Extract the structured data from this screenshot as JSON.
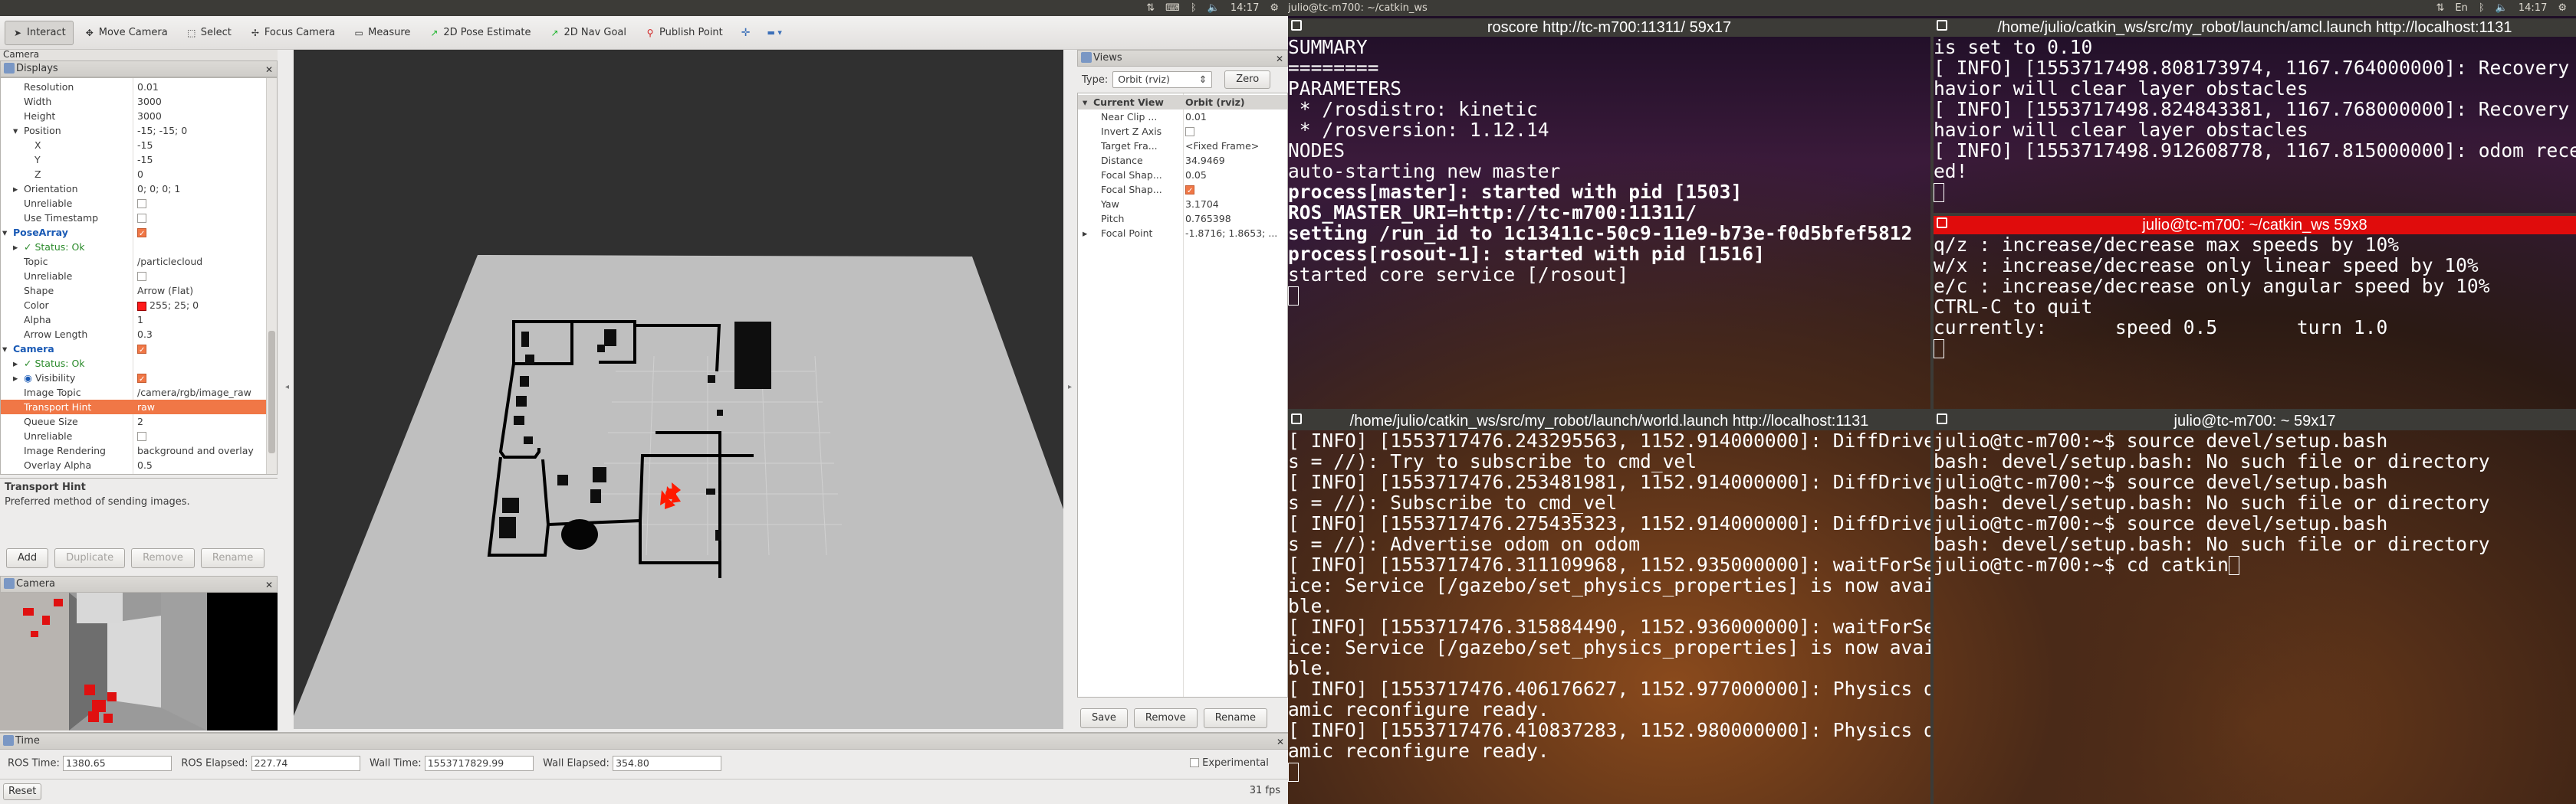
{
  "top_left": {
    "title": "",
    "time": "14:17"
  },
  "top_right": {
    "title": "julio@tc-m700: ~/catkin_ws",
    "time": "14:17",
    "lang": "En"
  },
  "toolbar": {
    "tools": [
      {
        "label": "Interact",
        "icon": "cursor-icon"
      },
      {
        "label": "Move Camera",
        "icon": "move-icon"
      },
      {
        "label": "Select",
        "icon": "select-icon"
      },
      {
        "label": "Focus Camera",
        "icon": "focus-icon"
      },
      {
        "label": "Measure",
        "icon": "ruler-icon"
      },
      {
        "label": "2D Pose Estimate",
        "icon": "pose-arrow-icon"
      },
      {
        "label": "2D Nav Goal",
        "icon": "goal-arrow-icon"
      },
      {
        "label": "Publish Point",
        "icon": "pin-icon"
      }
    ]
  },
  "camera_tab": "Camera",
  "displays": {
    "title": "Displays",
    "rows": [
      {
        "k": "Resolution",
        "v": "0.01",
        "ind": 2
      },
      {
        "k": "Width",
        "v": "3000",
        "ind": 2
      },
      {
        "k": "Height",
        "v": "3000",
        "ind": 2
      },
      {
        "k": "Position",
        "v": "-15; -15; 0",
        "ind": 2,
        "exp": "▾"
      },
      {
        "k": "X",
        "v": "-15",
        "ind": 3
      },
      {
        "k": "Y",
        "v": "-15",
        "ind": 3
      },
      {
        "k": "Z",
        "v": "0",
        "ind": 3
      },
      {
        "k": "Orientation",
        "v": "0; 0; 0; 1",
        "ind": 2,
        "exp": "▸"
      },
      {
        "k": "Unreliable",
        "v": "",
        "ind": 2,
        "chk": "off"
      },
      {
        "k": "Use Timestamp",
        "v": "",
        "ind": 2,
        "chk": "off"
      },
      {
        "k": "PoseArray",
        "v": "",
        "ind": 1,
        "exp": "▾",
        "chk": "on",
        "cls": "blue"
      },
      {
        "k": "Status: Ok",
        "v": "",
        "ind": 2,
        "exp": "▸",
        "cls": "green",
        "prefix": "✓"
      },
      {
        "k": "Topic",
        "v": "/particlecloud",
        "ind": 2
      },
      {
        "k": "Unreliable",
        "v": "",
        "ind": 2,
        "chk": "off"
      },
      {
        "k": "Shape",
        "v": "Arrow (Flat)",
        "ind": 2
      },
      {
        "k": "Color",
        "v": "255; 25; 0",
        "ind": 2,
        "swatch": true
      },
      {
        "k": "Alpha",
        "v": "1",
        "ind": 2
      },
      {
        "k": "Arrow Length",
        "v": "0.3",
        "ind": 2
      },
      {
        "k": "Camera",
        "v": "",
        "ind": 1,
        "exp": "▾",
        "chk": "on",
        "cls": "blue"
      },
      {
        "k": "Status: Ok",
        "v": "",
        "ind": 2,
        "exp": "▸",
        "cls": "green",
        "prefix": "✓"
      },
      {
        "k": "Visibility",
        "v": "",
        "ind": 2,
        "exp": "▸",
        "chk": "on",
        "prefix": "◉"
      },
      {
        "k": "Image Topic",
        "v": "/camera/rgb/image_raw",
        "ind": 2
      },
      {
        "k": "Transport Hint",
        "v": "raw",
        "ind": 2,
        "selected": true
      },
      {
        "k": "Queue Size",
        "v": "2",
        "ind": 2
      },
      {
        "k": "Unreliable",
        "v": "",
        "ind": 2,
        "chk": "off"
      },
      {
        "k": "Image Rendering",
        "v": "background and overlay",
        "ind": 2
      },
      {
        "k": "Overlay Alpha",
        "v": "0.5",
        "ind": 2
      }
    ]
  },
  "description": {
    "title": "Transport Hint",
    "text": "Preferred method of sending images."
  },
  "display_buttons": {
    "add": "Add",
    "duplicate": "Duplicate",
    "remove": "Remove",
    "rename": "Rename"
  },
  "camera_panel": {
    "title": "Camera"
  },
  "views": {
    "title": "Views",
    "type_label": "Type:",
    "type_value": "Orbit (rviz)",
    "zero": "Zero",
    "rows": [
      {
        "k": "Current View",
        "v": "Orbit (rviz)",
        "hdr": true
      },
      {
        "k": "Near Clip ...",
        "v": "0.01"
      },
      {
        "k": "Invert Z Axis",
        "v": "",
        "chk": "off"
      },
      {
        "k": "Target Fra...",
        "v": "<Fixed Frame>"
      },
      {
        "k": "Distance",
        "v": "34.9469"
      },
      {
        "k": "Focal Shap...",
        "v": "0.05"
      },
      {
        "k": "Focal Shap...",
        "v": "",
        "chk": "on"
      },
      {
        "k": "Yaw",
        "v": "3.1704"
      },
      {
        "k": "Pitch",
        "v": "0.765398"
      },
      {
        "k": "Focal Point",
        "v": "-1.8716; 1.8653; ...",
        "exp": true
      }
    ],
    "save": "Save",
    "remove": "Remove",
    "rename": "Rename"
  },
  "time_panel": {
    "title": "Time",
    "ros_time_label": "ROS Time:",
    "ros_time": "1380.65",
    "ros_elapsed_label": "ROS Elapsed:",
    "ros_elapsed": "227.74",
    "wall_time_label": "Wall Time:",
    "wall_time": "1553717829.99",
    "wall_elapsed_label": "Wall Elapsed:",
    "wall_elapsed": "354.80",
    "experimental": "Experimental",
    "reset": "Reset",
    "fps": "31 fps"
  },
  "panes": {
    "roscore": {
      "title": "roscore http://tc-m700:11311/ 59x17",
      "lines": [
        {
          "t": "SUMMARY"
        },
        {
          "t": "========"
        },
        {
          "t": ""
        },
        {
          "t": "PARAMETERS"
        },
        {
          "t": " * /rosdistro: kinetic"
        },
        {
          "t": " * /rosversion: 1.12.14"
        },
        {
          "t": ""
        },
        {
          "t": "NODES"
        },
        {
          "t": ""
        },
        {
          "t": "auto-starting new master"
        },
        {
          "t": "process[master]: started with pid [1503]",
          "b": true
        },
        {
          "t": "ROS_MASTER_URI=http://tc-m700:11311/",
          "b": true
        },
        {
          "t": ""
        },
        {
          "t": "setting /run_id to 1c13411c-50c9-11e9-b73e-f0d5bfef5812",
          "b": true
        },
        {
          "t": "process[rosout-1]: started with pid [1516]",
          "b": true
        },
        {
          "t": "started core service [/rosout]"
        }
      ]
    },
    "amcl": {
      "title": "/home/julio/catkin_ws/src/my_robot/launch/amcl.launch http://localhost:1131",
      "lines": [
        {
          "t": "is set to 0.10"
        },
        {
          "t": "[ INFO] [1553717498.808173974, 1167.764000000]: Recovery be"
        },
        {
          "t": "havior will clear layer obstacles"
        },
        {
          "t": "[ INFO] [1553717498.824843381, 1167.768000000]: Recovery be"
        },
        {
          "t": "havior will clear layer obstacles"
        },
        {
          "t": "[ INFO] [1553717498.912608778, 1167.815000000]: odom receiv"
        },
        {
          "t": "ed!"
        }
      ]
    },
    "teleop": {
      "title": "julio@tc-m700: ~/catkin_ws 59x8",
      "lines": [
        {
          "t": "q/z : increase/decrease max speeds by 10%"
        },
        {
          "t": "w/x : increase/decrease only linear speed by 10%"
        },
        {
          "t": "e/c : increase/decrease only angular speed by 10%"
        },
        {
          "t": ""
        },
        {
          "t": "CTRL-C to quit"
        },
        {
          "t": ""
        },
        {
          "t": "currently:      speed 0.5       turn 1.0"
        }
      ]
    },
    "world": {
      "title": "/home/julio/catkin_ws/src/my_robot/launch/world.launch http://localhost:1131",
      "lines": [
        {
          "t": "[ INFO] [1553717476.243295563, 1152.914000000]: DiffDrive(n"
        },
        {
          "t": "s = //): Try to subscribe to cmd_vel"
        },
        {
          "t": "[ INFO] [1553717476.253481981, 1152.914000000]: DiffDrive(n"
        },
        {
          "t": "s = //): Subscribe to cmd_vel"
        },
        {
          "t": "[ INFO] [1553717476.275435323, 1152.914000000]: DiffDrive(n"
        },
        {
          "t": "s = //): Advertise odom on odom"
        },
        {
          "t": "[ INFO] [1553717476.311109968, 1152.935000000]: waitForServ"
        },
        {
          "t": "ice: Service [/gazebo/set_physics_properties] is now availa"
        },
        {
          "t": "ble."
        },
        {
          "t": "[ INFO] [1553717476.315884490, 1152.936000000]: waitForServ"
        },
        {
          "t": "ice: Service [/gazebo/set_physics_properties] is now availa"
        },
        {
          "t": "ble."
        },
        {
          "t": "[ INFO] [1553717476.406176627, 1152.977000000]: Physics dyn"
        },
        {
          "t": "amic reconfigure ready."
        },
        {
          "t": "[ INFO] [1553717476.410837283, 1152.980000000]: Physics dyn"
        },
        {
          "t": "amic reconfigure ready."
        }
      ]
    },
    "shell": {
      "title": "julio@tc-m700: ~ 59x17",
      "lines": [
        {
          "t": "julio@tc-m700:~$ source devel/setup.bash"
        },
        {
          "t": "bash: devel/setup.bash: No such file or directory"
        },
        {
          "t": "julio@tc-m700:~$ source devel/setup.bash"
        },
        {
          "t": "bash: devel/setup.bash: No such file or directory"
        },
        {
          "t": "julio@tc-m700:~$ source devel/setup.bash"
        },
        {
          "t": "bash: devel/setup.bash: No such file or directory"
        },
        {
          "t": "julio@tc-m700:~$ cd catkin"
        }
      ]
    }
  }
}
